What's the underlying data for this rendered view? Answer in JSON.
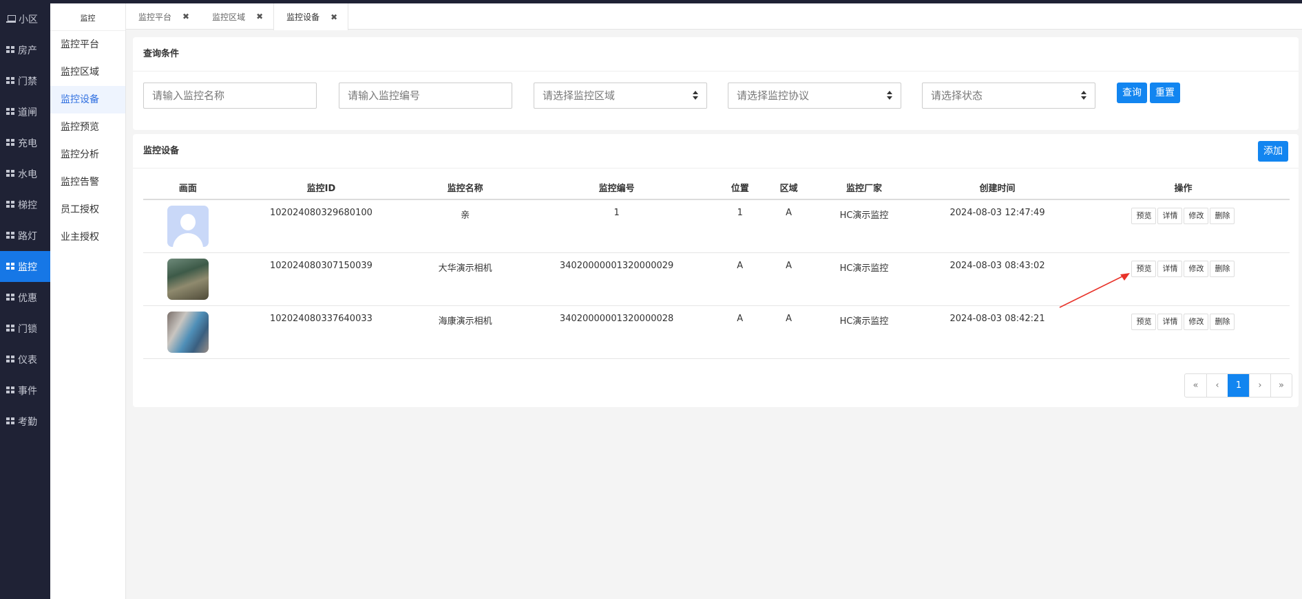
{
  "nav": [
    {
      "label": "小区",
      "icon": "laptop-icon",
      "active": false
    },
    {
      "label": "房产",
      "icon": "grid-icon",
      "active": false
    },
    {
      "label": "门禁",
      "icon": "grid-icon",
      "active": false
    },
    {
      "label": "道闸",
      "icon": "grid-icon",
      "active": false
    },
    {
      "label": "充电",
      "icon": "grid-icon",
      "active": false
    },
    {
      "label": "水电",
      "icon": "grid-icon",
      "active": false
    },
    {
      "label": "梯控",
      "icon": "grid-icon",
      "active": false
    },
    {
      "label": "路灯",
      "icon": "grid-icon",
      "active": false
    },
    {
      "label": "监控",
      "icon": "grid-icon",
      "active": true
    },
    {
      "label": "优惠",
      "icon": "grid-icon",
      "active": false
    },
    {
      "label": "门锁",
      "icon": "grid-icon",
      "active": false
    },
    {
      "label": "仪表",
      "icon": "grid-icon",
      "active": false
    },
    {
      "label": "事件",
      "icon": "grid-icon",
      "active": false
    },
    {
      "label": "考勤",
      "icon": "grid-icon",
      "active": false
    }
  ],
  "submenu": {
    "title": "监控",
    "items": [
      {
        "label": "监控平台",
        "active": false
      },
      {
        "label": "监控区域",
        "active": false
      },
      {
        "label": "监控设备",
        "active": true
      },
      {
        "label": "监控预览",
        "active": false
      },
      {
        "label": "监控分析",
        "active": false
      },
      {
        "label": "监控告警",
        "active": false
      },
      {
        "label": "员工授权",
        "active": false
      },
      {
        "label": "业主授权",
        "active": false
      }
    ]
  },
  "tabs": [
    {
      "label": "监控平台",
      "close": "✖",
      "active": false
    },
    {
      "label": "监控区域",
      "close": "✖",
      "active": false
    },
    {
      "label": "监控设备",
      "close": "✖",
      "active": true
    }
  ],
  "query": {
    "title": "查询条件",
    "name_placeholder": "请输入监控名称",
    "code_placeholder": "请输入监控编号",
    "area_select": "请选择监控区域",
    "protocol_select": "请选择监控协议",
    "status_select": "请选择状态",
    "search_label": "查询",
    "reset_label": "重置"
  },
  "list": {
    "title": "监控设备",
    "add_label": "添加",
    "columns": [
      "画面",
      "监控ID",
      "监控名称",
      "监控编号",
      "位置",
      "区域",
      "监控厂家",
      "创建时间",
      "操作"
    ],
    "rows": [
      {
        "thumb": "avatar",
        "id": "102024080329680100",
        "name": "亲",
        "code": "1",
        "position": "1",
        "area": "A",
        "vendor": "HC演示监控",
        "created": "2024-08-03 12:47:49"
      },
      {
        "thumb": "cam1",
        "id": "102024080307150039",
        "name": "大华演示相机",
        "code": "34020000001320000029",
        "position": "A",
        "area": "A",
        "vendor": "HC演示监控",
        "created": "2024-08-03 08:43:02"
      },
      {
        "thumb": "cam2",
        "id": "102024080337640033",
        "name": "海康演示相机",
        "code": "34020000001320000028",
        "position": "A",
        "area": "A",
        "vendor": "HC演示监控",
        "created": "2024-08-03 08:42:21"
      }
    ],
    "actions": [
      "预览",
      "详情",
      "修改",
      "删除"
    ]
  },
  "pager": {
    "first": "«",
    "prev": "‹",
    "current": "1",
    "next": "›",
    "last": "»"
  },
  "colors": {
    "primary": "#1285f0",
    "nav_bg": "#1f2235",
    "annotation": "#e8332a"
  }
}
